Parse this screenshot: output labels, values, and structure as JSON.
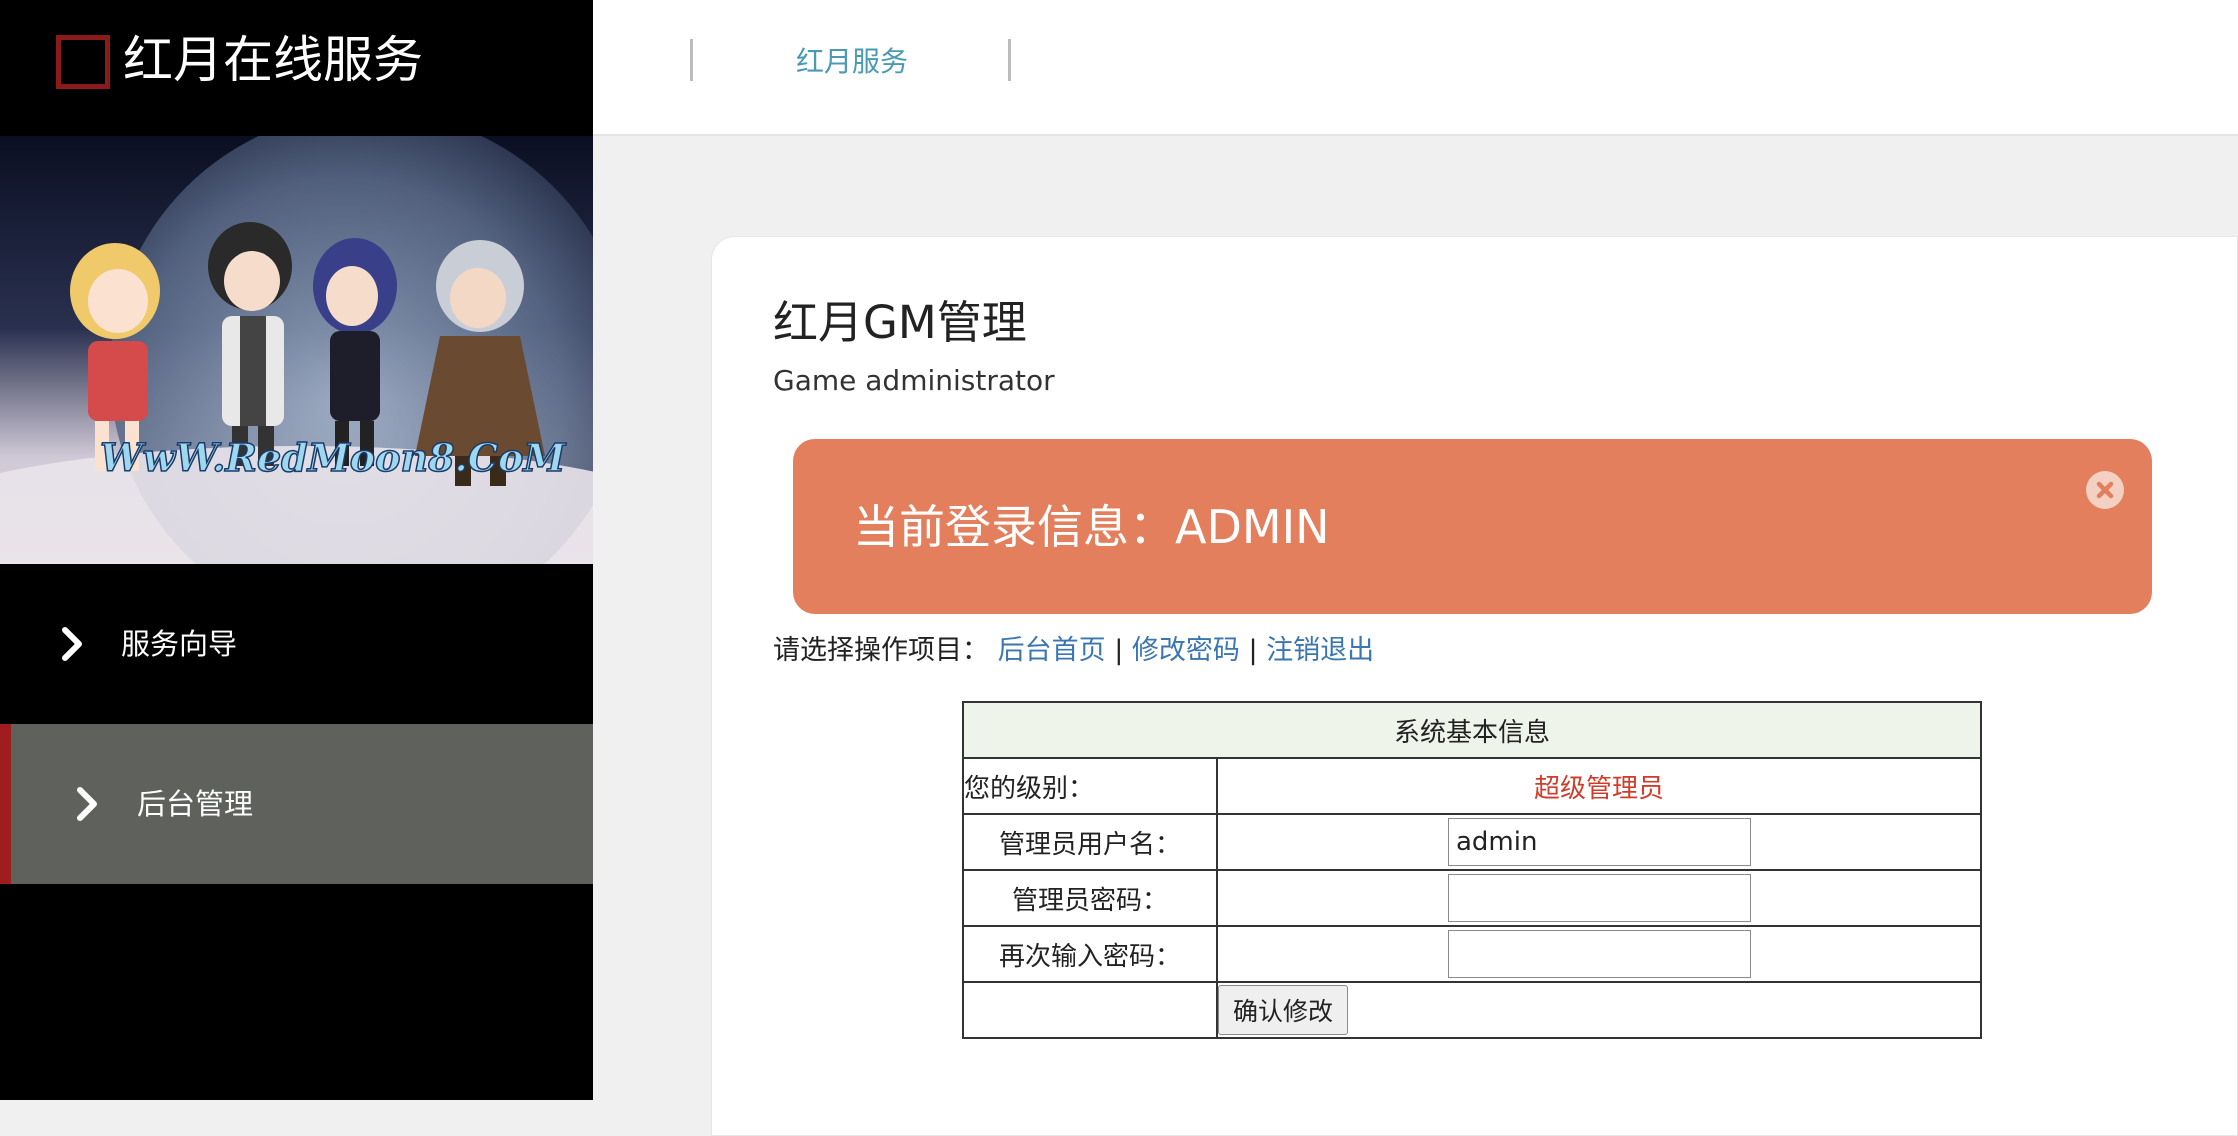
{
  "brand": {
    "title": "红月在线服务"
  },
  "banner": {
    "watermark": "WwW.RedMoon8.CoM"
  },
  "sidebar": {
    "items": [
      {
        "label": "服务向导"
      },
      {
        "label": "后台管理"
      }
    ]
  },
  "topbar": {
    "link": "红月服务"
  },
  "main": {
    "title": "红月GM管理",
    "subtitle": "Game administrator",
    "alert": {
      "text": "当前登录信息：ADMIN"
    },
    "ops": {
      "prompt": "请选择操作项目：",
      "links": [
        "后台首页",
        "修改密码",
        "注销退出"
      ],
      "separator": "|"
    },
    "table": {
      "heading": "系统基本信息",
      "level_label": "您的级别：",
      "level_value": "超级管理员",
      "username_label": "管理员用户名：",
      "username_value": "admin",
      "password_label": "管理员密码：",
      "password_value": "",
      "confirm_label": "再次输入密码：",
      "confirm_value": "",
      "submit_label": "确认修改"
    }
  },
  "colors": {
    "accent_red": "#a01d1d",
    "alert_bg": "#e37f5d",
    "link_blue": "#3a76b2",
    "level_red": "#d13c2a",
    "topbar_link": "#4a9ab3"
  }
}
